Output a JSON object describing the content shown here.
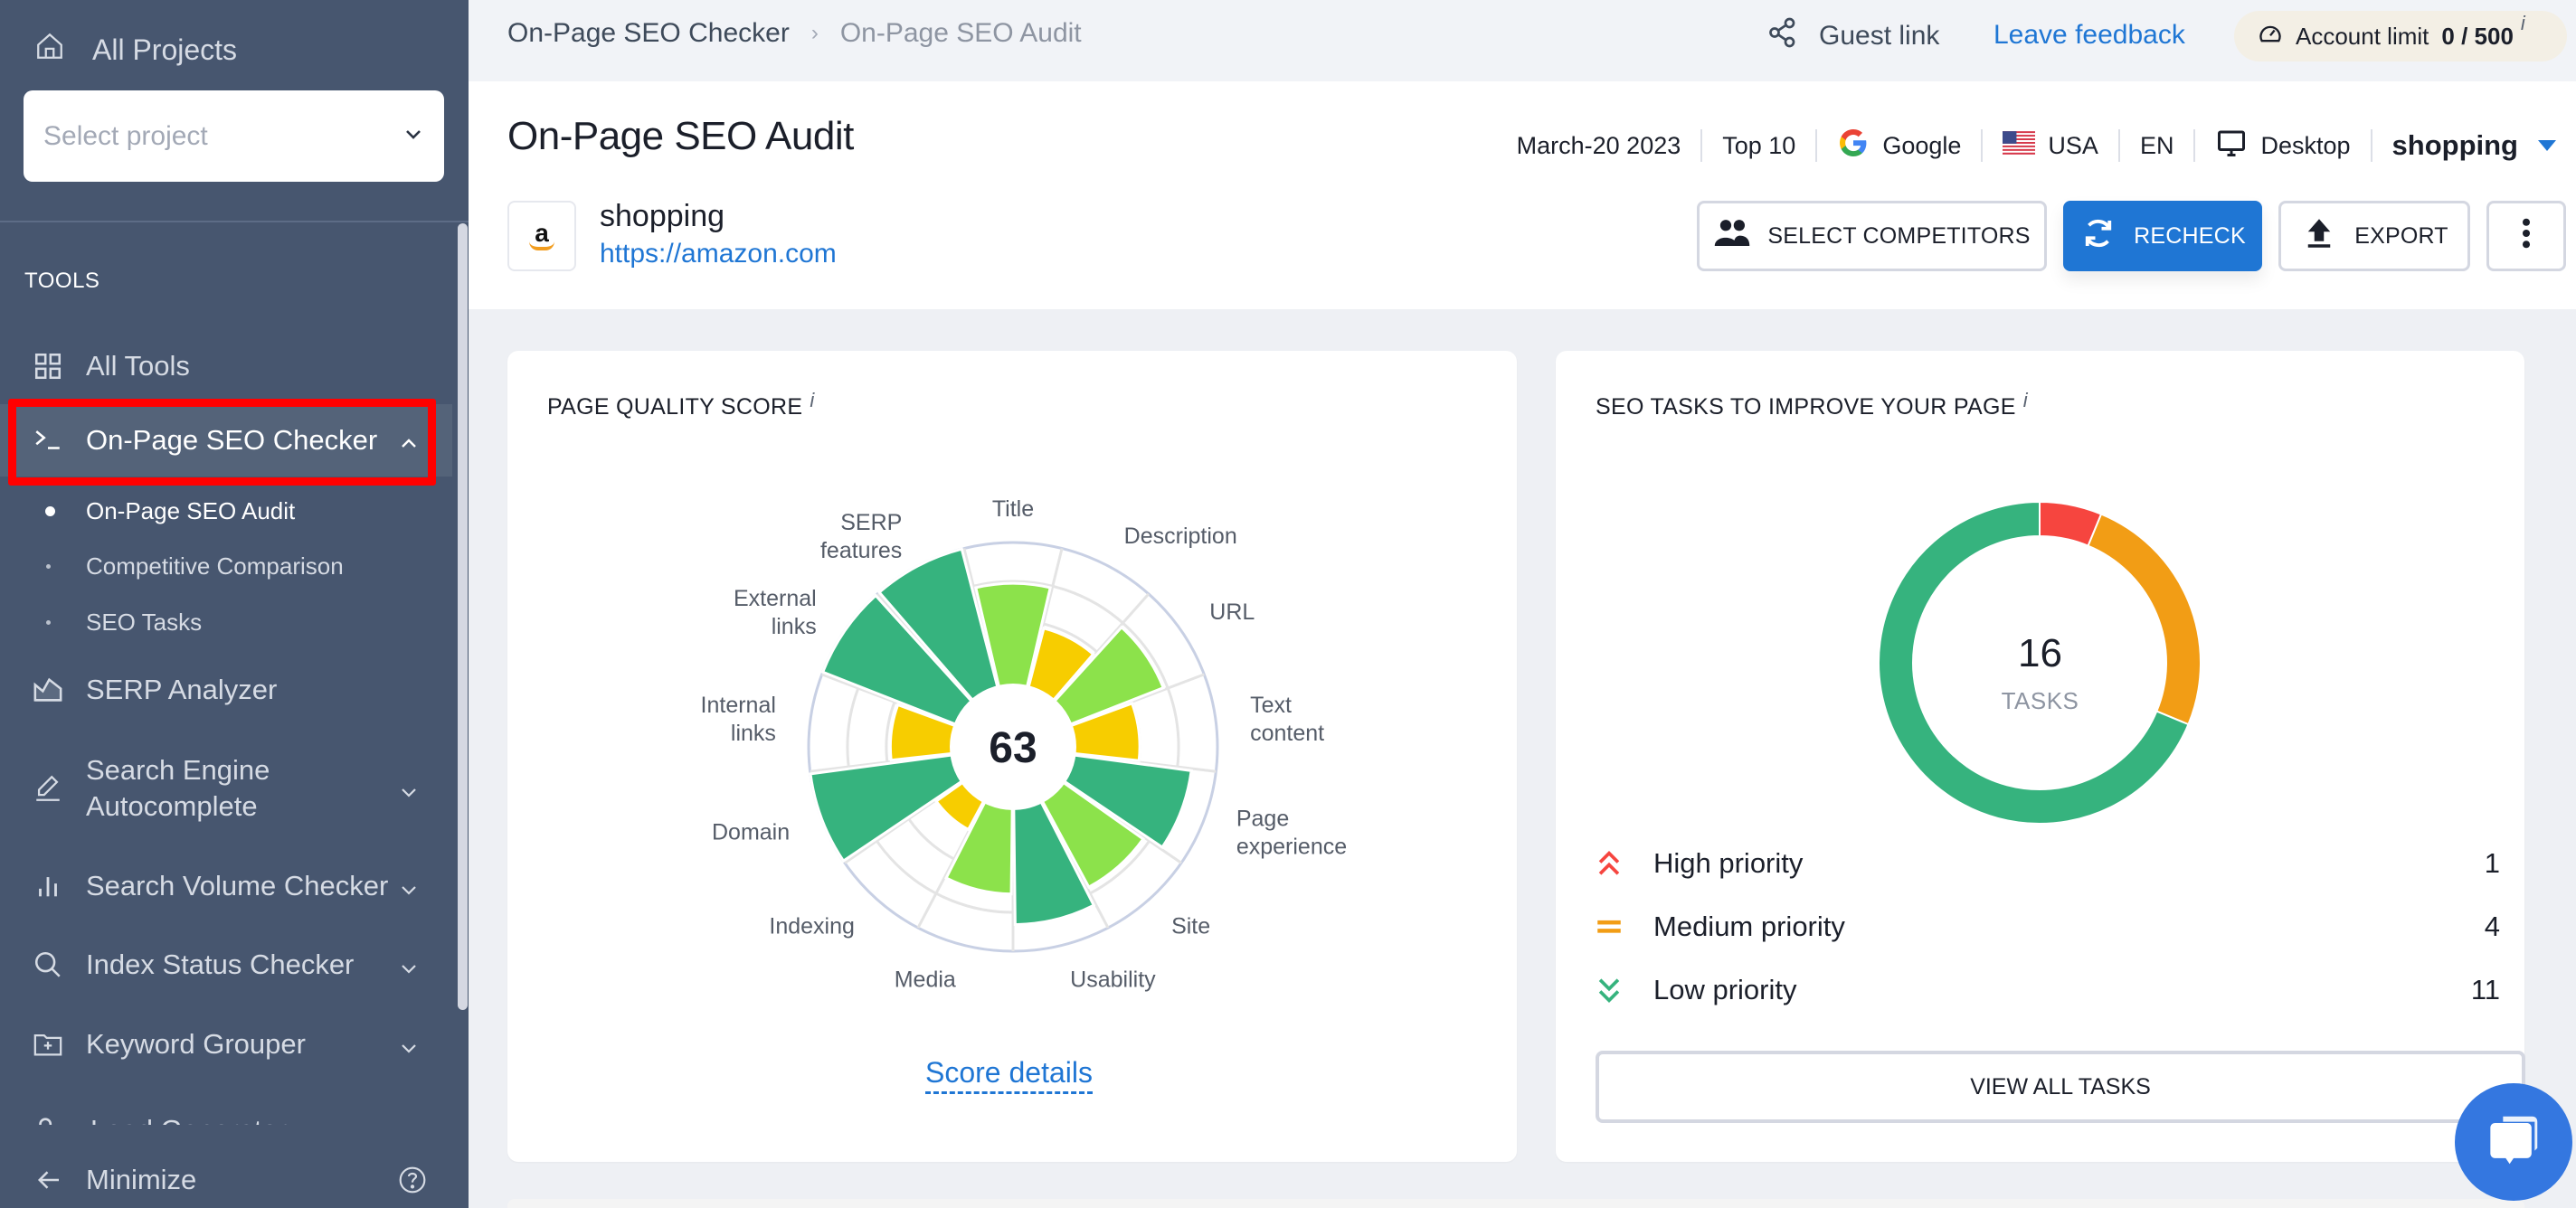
{
  "sidebar": {
    "all_projects": "All Projects",
    "select_project_placeholder": "Select project",
    "tools_label": "TOOLS",
    "items": [
      {
        "label": "All Tools",
        "icon": "grid-icon"
      },
      {
        "label": "On-Page SEO Checker",
        "icon": "terminal-icon",
        "expanded": true,
        "active": true
      },
      {
        "label": "SERP Analyzer",
        "icon": "chart-area-icon"
      },
      {
        "label": "Search Engine Autocomplete",
        "label_line1": "Search Engine",
        "label_line2": "Autocomplete",
        "icon": "pencil-icon"
      },
      {
        "label": "Search Volume Checker",
        "icon": "bar-chart-icon"
      },
      {
        "label": "Index Status Checker",
        "icon": "search-icon"
      },
      {
        "label": "Keyword Grouper",
        "icon": "folder-plus-icon"
      },
      {
        "label": "Lead Generator",
        "icon": "user-icon"
      }
    ],
    "sub_items": [
      {
        "label": "On-Page SEO Audit",
        "active": true
      },
      {
        "label": "Competitive Comparison",
        "active": false
      },
      {
        "label": "SEO Tasks",
        "active": false
      }
    ],
    "minimize": "Minimize"
  },
  "topbar": {
    "breadcrumb": [
      "On-Page SEO Checker",
      "On-Page SEO Audit"
    ],
    "guest_link": "Guest link",
    "leave_feedback": "Leave feedback",
    "account_limit_label": "Account limit",
    "account_limit_value": "0 / 500",
    "info": "i"
  },
  "header": {
    "title": "On-Page SEO Audit",
    "project_name": "shopping",
    "project_url": "https://amazon.com",
    "logo_letter": "a",
    "meta": {
      "date": "March-20 2023",
      "top": "Top 10",
      "engine": "Google",
      "country": "USA",
      "language": "EN",
      "device": "Desktop",
      "keyword": "shopping"
    },
    "buttons": {
      "select_competitors": "SELECT COMPETITORS",
      "recheck": "RECHECK",
      "export": "EXPORT"
    }
  },
  "quality_card": {
    "title": "PAGE QUALITY SCORE",
    "info": "i",
    "score": "63",
    "score_details": "Score details"
  },
  "tasks_card": {
    "title": "SEO TASKS TO IMPROVE YOUR PAGE",
    "info": "i",
    "total": "16",
    "total_label": "TASKS",
    "priorities": [
      {
        "label": "High priority",
        "count": "1",
        "color": "#f6453f"
      },
      {
        "label": "Medium priority",
        "count": "4",
        "color": "#f29d15"
      },
      {
        "label": "Low priority",
        "count": "11",
        "color": "#36b37e"
      }
    ],
    "view_all": "VIEW ALL TASKS"
  },
  "colors": {
    "sidebar_bg": "#47566f",
    "accent_blue": "#1f76d4",
    "high": "#f6453f",
    "medium": "#f29d15",
    "low": "#36b37e",
    "score_dark_green": "#36b37e",
    "score_light_green": "#8ce24b",
    "score_yellow": "#f7cd00"
  },
  "chart_data": [
    {
      "type": "polar-area",
      "title": "PAGE QUALITY SCORE",
      "center_label": "63",
      "categories": [
        "Title",
        "Description",
        "URL",
        "Text content",
        "Page experience",
        "Site",
        "Usability",
        "Media",
        "Indexing",
        "Domain",
        "Internal links",
        "External links",
        "SERP features"
      ],
      "values": [
        80,
        60,
        79,
        62,
        88,
        78,
        87,
        72,
        46,
        100,
        60,
        100,
        100
      ],
      "value_range": [
        0,
        100
      ],
      "color_classes": [
        "light-green",
        "yellow",
        "light-green",
        "yellow",
        "dark-green",
        "light-green",
        "dark-green",
        "light-green",
        "yellow",
        "dark-green",
        "yellow",
        "dark-green",
        "dark-green"
      ],
      "grid": true
    },
    {
      "type": "pie",
      "title": "SEO TASKS TO IMPROVE YOUR PAGE",
      "donut": true,
      "categories": [
        "High priority",
        "Medium priority",
        "Low priority"
      ],
      "values": [
        1,
        4,
        11
      ],
      "total": 16
    }
  ]
}
